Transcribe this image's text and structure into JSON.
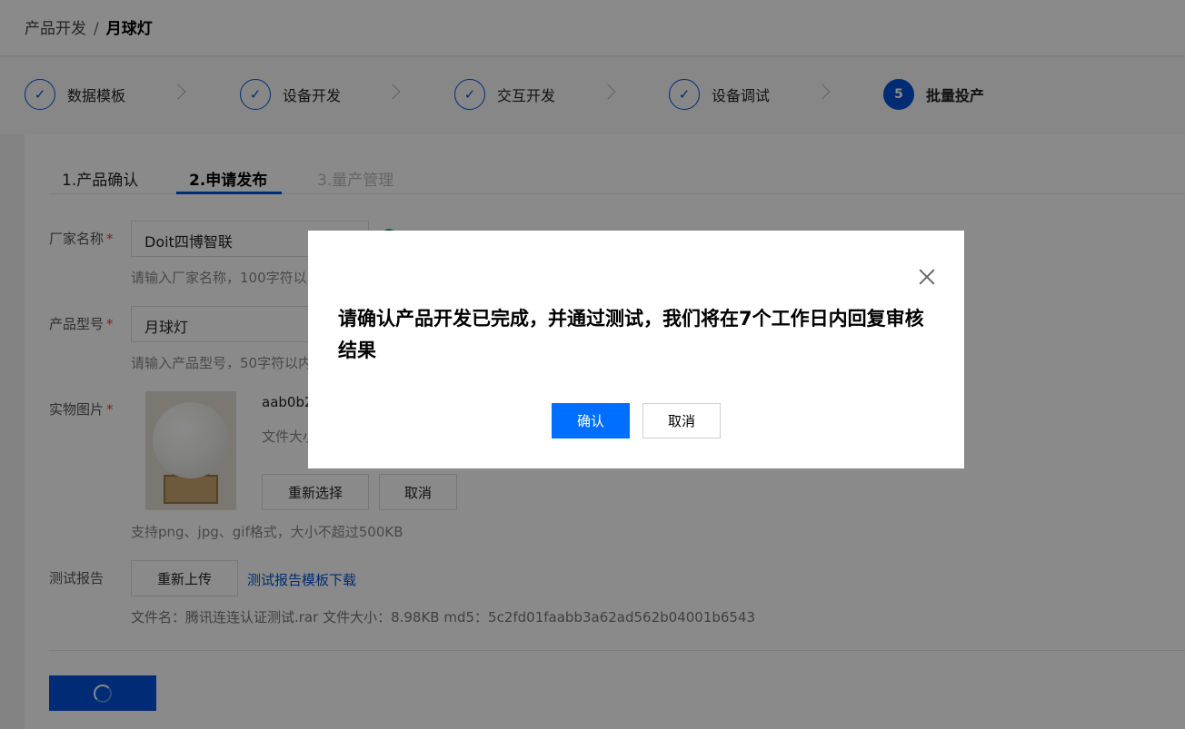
{
  "breadcrumb": {
    "parent": "产品开发",
    "separator": "/",
    "current": "月球灯"
  },
  "steps": [
    {
      "label": "数据模板",
      "state": "done",
      "icon": "check-icon"
    },
    {
      "label": "设备开发",
      "state": "done",
      "icon": "check-icon"
    },
    {
      "label": "交互开发",
      "state": "done",
      "icon": "check-icon"
    },
    {
      "label": "设备调试",
      "state": "done",
      "icon": "check-icon"
    },
    {
      "label": "批量投产",
      "state": "active",
      "number": "5"
    }
  ],
  "tabs": [
    {
      "label": "1.产品确认",
      "state": "normal"
    },
    {
      "label": "2.申请发布",
      "state": "active"
    },
    {
      "label": "3.量产管理",
      "state": "disabled"
    }
  ],
  "form": {
    "manufacturer": {
      "label": "厂家名称",
      "required": "*",
      "value": "Doit四博智联",
      "hint": "请输入厂家名称，100字符以"
    },
    "model": {
      "label": "产品型号",
      "required": "*",
      "value": "月球灯",
      "hint": "请输入产品型号，50字符以内"
    },
    "image": {
      "label": "实物图片",
      "required": "*",
      "file_name": "aab0b2",
      "file_meta": "文件大小",
      "reselect_label": "重新选择",
      "cancel_label": "取消",
      "hint": "支持png、jpg、gif格式，大小不超过500KB"
    },
    "report": {
      "label": "测试报告",
      "reupload_label": "重新上传",
      "template_link": "测试报告模板下载",
      "file_info": "文件名：腾讯连连认证测试.rar  文件大小：8.98KB  md5：5c2fd01faabb3a62ad562b04001b6543"
    }
  },
  "submit_button": {
    "icon": "loading-spinner-icon"
  },
  "modal": {
    "message": "请确认产品开发已完成，并通过测试，我们将在7个工作日内回复审核结果",
    "confirm_label": "确认",
    "cancel_label": "取消",
    "close_icon": "close-icon"
  },
  "colors": {
    "brand": "#0052d9",
    "primary_button": "#006eff",
    "required": "#e54545",
    "success": "#0abf5b",
    "overlay": "rgba(0,0,0,0.46)"
  }
}
